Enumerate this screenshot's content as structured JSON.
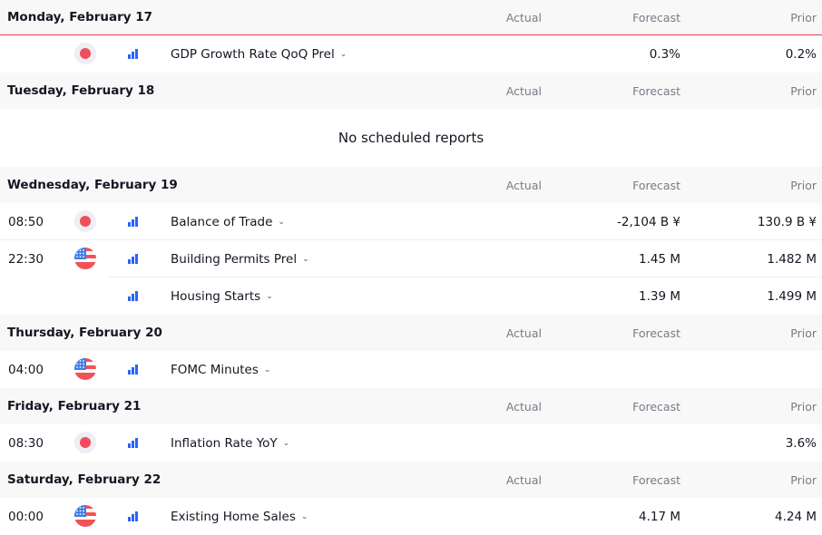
{
  "columns": {
    "actual": "Actual",
    "forecast": "Forecast",
    "prior": "Prior"
  },
  "colors": {
    "accent_line": "#e0404f",
    "importance_bars": "#2962ff",
    "jp_red": "#f04e5c"
  },
  "days": [
    {
      "title": "Monday, February 17",
      "events": [
        {
          "time": "",
          "country": "JP",
          "flag_icon": "japan-flag-icon",
          "name": "GDP Growth Rate QoQ Prel",
          "actual": "",
          "forecast": "0.3%",
          "prior": "0.2%"
        }
      ]
    },
    {
      "title": "Tuesday, February 18",
      "empty_message": "No scheduled reports",
      "events": []
    },
    {
      "title": "Wednesday, February 19",
      "events": [
        {
          "time": "08:50",
          "country": "JP",
          "flag_icon": "japan-flag-icon",
          "name": "Balance of Trade",
          "actual": "",
          "forecast": "-2,104 B ¥",
          "prior": "130.9 B ¥"
        },
        {
          "time": "22:30",
          "country": "US",
          "flag_icon": "us-flag-icon",
          "name": "Building Permits Prel",
          "actual": "",
          "forecast": "1.45 M",
          "prior": "1.482 M"
        },
        {
          "time": "",
          "country": "",
          "flag_icon": "",
          "name": "Housing Starts",
          "actual": "",
          "forecast": "1.39 M",
          "prior": "1.499 M"
        }
      ]
    },
    {
      "title": "Thursday, February 20",
      "events": [
        {
          "time": "04:00",
          "country": "US",
          "flag_icon": "us-flag-icon",
          "name": "FOMC Minutes",
          "actual": "",
          "forecast": "",
          "prior": ""
        }
      ]
    },
    {
      "title": "Friday, February 21",
      "events": [
        {
          "time": "08:30",
          "country": "JP",
          "flag_icon": "japan-flag-icon",
          "name": "Inflation Rate YoY",
          "actual": "",
          "forecast": "",
          "prior": "3.6%"
        }
      ]
    },
    {
      "title": "Saturday, February 22",
      "events": [
        {
          "time": "00:00",
          "country": "US",
          "flag_icon": "us-flag-icon",
          "name": "Existing Home Sales",
          "actual": "",
          "forecast": "4.17 M",
          "prior": "4.24 M"
        }
      ]
    }
  ]
}
